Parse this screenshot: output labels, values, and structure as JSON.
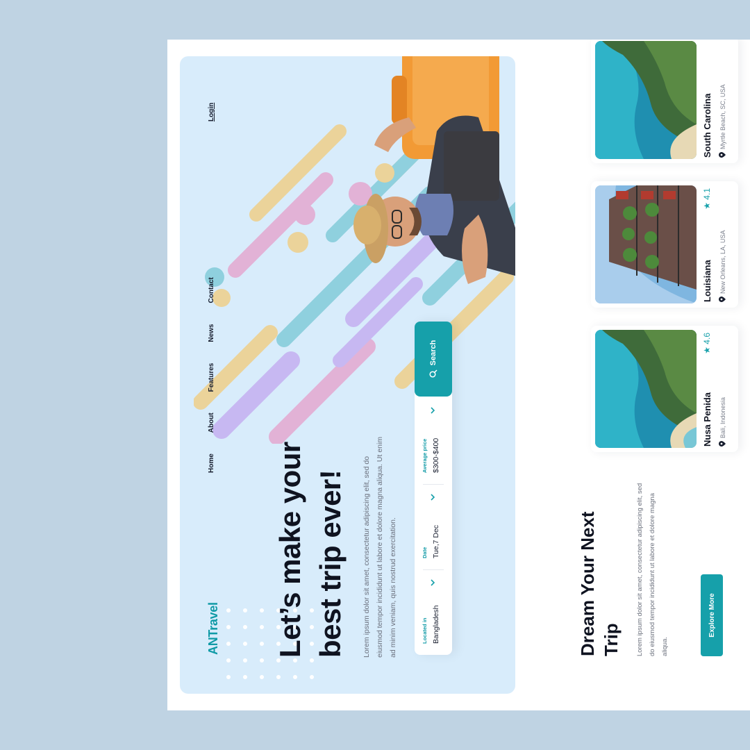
{
  "brand": {
    "logo_prefix": "AN",
    "logo_suffix": "Travel"
  },
  "nav": {
    "items": [
      "Home",
      "About",
      "Features",
      "News",
      "Contact"
    ],
    "login": "Login"
  },
  "hero": {
    "headline": "Let’s make your best trip ever!",
    "description": "Lorem ipsum dolor sit amet, consectetur adipiscing elit, sed do eiusmod tempor incididunt ut labore et dolore magna aliqua. Ut enim ad minim veniam, quis nostrud exercitation."
  },
  "search": {
    "fields": [
      {
        "label": "Located in",
        "value": "Bangladesh"
      },
      {
        "label": "Date",
        "value": "Tue,7 Dec"
      },
      {
        "label": "Average price",
        "value": "$300-$400"
      }
    ],
    "button": "Search"
  },
  "dream": {
    "title": "Dream Your Next Trip",
    "description": "Lorem ipsum dolor sit amet, consectetur adipiscing elit, sed do eiusmod tempor incididunt ut labore et dolore magna aliqua.",
    "button": "Explore More"
  },
  "destinations": [
    {
      "name": "Nusa Penida",
      "location": "Bali, Indonesia",
      "rating": "4.6",
      "image": "coastal-cliff-aerial"
    },
    {
      "name": "Louisiana",
      "location": "New Orleans, LA, USA",
      "rating": "4.1",
      "image": "balcony-building"
    },
    {
      "name": "South Carolina",
      "location": "Myrtle Beach, SC, USA",
      "rating": "",
      "image": "coastal-cliff-aerial"
    }
  ],
  "colors": {
    "accent": "#16a0aa",
    "hero_bg": "#d8ecfb",
    "page_bg": "#bfd3e3"
  }
}
